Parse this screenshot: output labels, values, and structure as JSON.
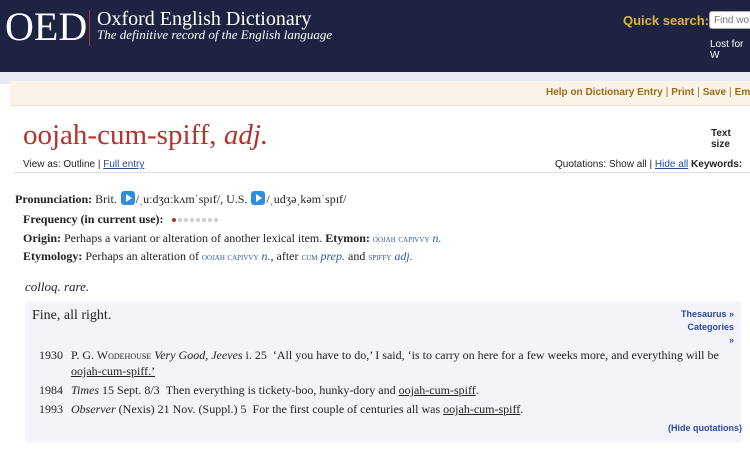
{
  "header": {
    "logo": "OED",
    "title": "Oxford English Dictionary",
    "tagline": "The definitive record of the English language",
    "quick_search_label": "Quick search:",
    "quick_search_placeholder": "Find wo",
    "lost_link": "Lost for W"
  },
  "toolbar": {
    "help": "Help on Dictionary Entry",
    "print": "Print",
    "save": "Save",
    "email": "Em",
    "sep": "|"
  },
  "entry": {
    "headword": "oojah-cum-spiff,",
    "pos": "adj.",
    "text_size": "Text size",
    "view_as_label": "View as:",
    "view_outline": "Outline",
    "view_full": "Full entry",
    "quotations_label": "Quotations:",
    "show_all": "Show all",
    "hide_all": "Hide all",
    "keywords_label": "Keywords:",
    "pronunciation_label": "Pronunciation:",
    "brit_label": "Brit.",
    "brit_ipa": "/ˌuːdʒɑːkʌmˈspɪf/",
    "us_label": "U.S.",
    "us_ipa": "/ˌudʒəˌkəmˈspɪf/",
    "frequency_label": "Frequency (in current use):",
    "frequency_level": 1,
    "frequency_max": 8,
    "origin_label": "Origin:",
    "origin_text": "Perhaps a variant or alteration of another lexical item.",
    "etymon_label": "Etymon:",
    "etymon_word": "oojah capivvy",
    "etymon_pos": "n.",
    "etymology_label": "Etymology:",
    "etymology_pre": "Perhaps an alteration of",
    "etym_word1": "oojah capivvy",
    "etym_pos1": "n.",
    "etym_after": ", after",
    "etym_word2": "cum",
    "etym_pos2": "prep.",
    "etym_and": "and",
    "etym_word3": "spiffy",
    "etym_pos3": "adj.",
    "usage": "colloq. rare.",
    "definition": "Fine, all right.",
    "thesaurus": "Thesaurus »",
    "categories": "Categories »",
    "hide_quotations": "(Hide quotations)"
  },
  "quotations": [
    {
      "year": "1930",
      "author": "P. G. Wodehouse",
      "work": "Very Good, Jeeves",
      "ref": "i. 25",
      "text_line1": "‘All you have to do,’ I said, ‘is to carry on here for a few weeks more, and everything will be",
      "text_line2": "oojah-cum-spiff.’"
    },
    {
      "year": "1984",
      "work": "Times",
      "ref": "15 Sept. 8/3",
      "text_pre": "Then everything is tickety-boo, hunky-dory and",
      "text_word": "oojah-cum-spiff",
      "text_post": "."
    },
    {
      "year": "1993",
      "work": "Observer",
      "ref": "(Nexis) 21 Nov. (Suppl.) 5",
      "text_pre": "For the first couple of centuries all was",
      "text_word": "oojah-cum-spiff",
      "text_post": "."
    }
  ],
  "colors": {
    "header_bg": "#1e2342",
    "headword": "#b4322f",
    "link": "#2a4aa0",
    "accent": "#e0b340"
  }
}
